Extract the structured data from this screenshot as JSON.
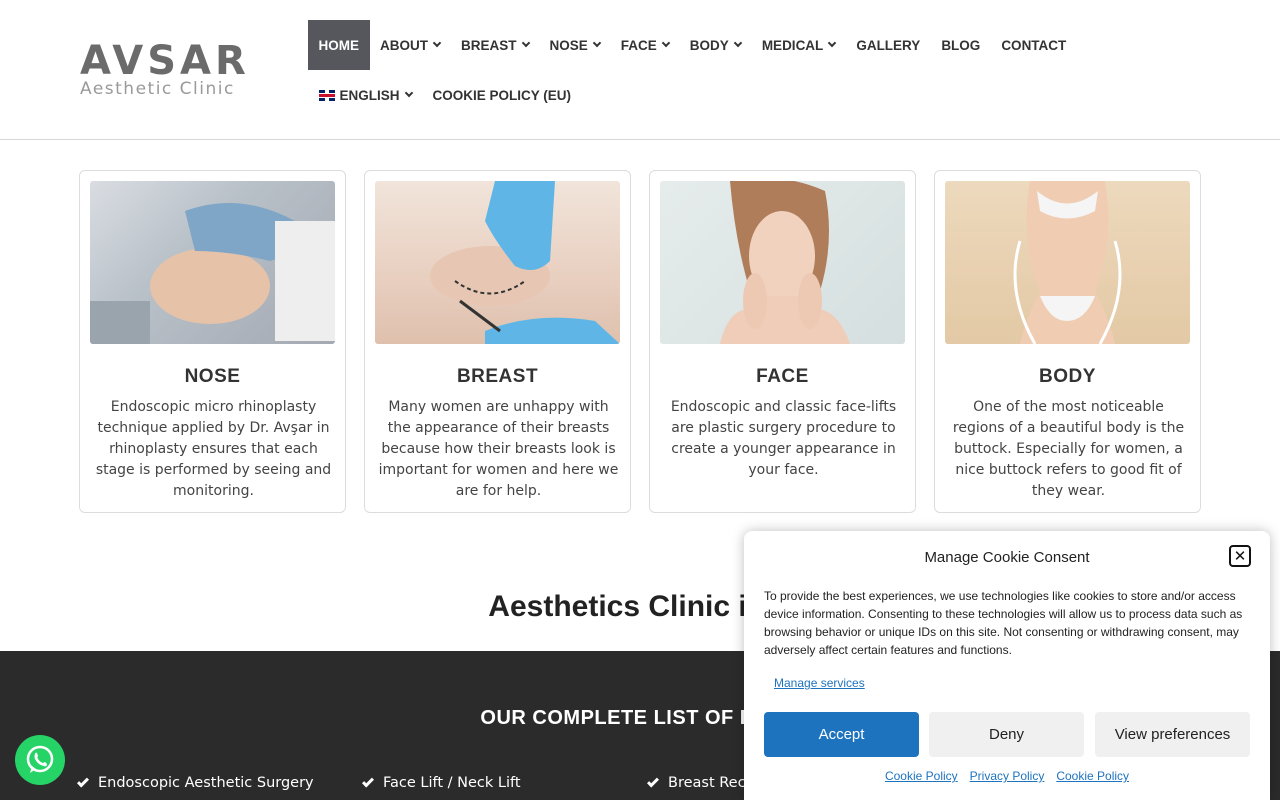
{
  "logo": {
    "main": "AVSAR",
    "sub": "Aesthetic Clinic"
  },
  "nav": {
    "row1": [
      {
        "label": "HOME",
        "dropdown": false,
        "active": true
      },
      {
        "label": "ABOUT",
        "dropdown": true
      },
      {
        "label": "BREAST",
        "dropdown": true
      },
      {
        "label": "NOSE",
        "dropdown": true
      },
      {
        "label": "FACE",
        "dropdown": true
      },
      {
        "label": "BODY",
        "dropdown": true
      },
      {
        "label": "MEDICAL",
        "dropdown": true
      },
      {
        "label": "GALLERY",
        "dropdown": false
      },
      {
        "label": "BLOG",
        "dropdown": false
      },
      {
        "label": "CONTACT",
        "dropdown": false
      }
    ],
    "row2": [
      {
        "label": "ENGLISH",
        "dropdown": true,
        "icon": "uk-flag-icon"
      },
      {
        "label": "COOKIE POLICY (EU)",
        "dropdown": false
      }
    ]
  },
  "cards": [
    {
      "title": "NOSE",
      "text": "Endoscopic micro rhinoplasty technique applied by Dr. Avşar in rhinoplasty ensures that each stage is performed by seeing and monitoring."
    },
    {
      "title": "BREAST",
      "text": "Many women are unhappy with the appearance of their breasts because how their breasts look is important for women and here we are for help."
    },
    {
      "title": "FACE",
      "text": "Endoscopic and classic face-lifts are plastic surgery procedure to create a younger appearance in your face."
    },
    {
      "title": "BODY",
      "text": "One of the most noticeable regions of a beautiful body is the buttock. Especially for women, a nice buttock refers to good fit of they wear."
    }
  ],
  "section_title": "Aesthetics Clinic in T",
  "procedures": {
    "title": "OUR COMPLETE LIST OF PROC",
    "items": [
      "Endoscopic Aesthetic Surgery",
      "Face Lift / Neck Lift",
      "Breast Rec"
    ]
  },
  "cookie": {
    "title": "Manage Cookie Consent",
    "close": "✕",
    "text": "To provide the best experiences, we use technologies like cookies to store and/or access device information. Consenting to these technologies will allow us to process data such as browsing behavior or unique IDs on this site. Not consenting or withdrawing consent, may adversely affect certain features and functions.",
    "manage": "Manage services",
    "accept": "Accept",
    "deny": "Deny",
    "view": "View preferences",
    "links": [
      "Cookie Policy",
      "Privacy Policy",
      "Cookie Policy"
    ]
  },
  "colors": {
    "nav_active": "#55575c",
    "dark_band": "#2b2b2b",
    "accent_blue": "#1e73be",
    "whatsapp": "#25d366"
  }
}
